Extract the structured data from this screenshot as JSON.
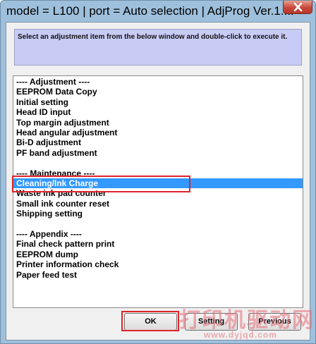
{
  "window": {
    "title": "model = L100 | port = Auto selection | AdjProg Ver.1....",
    "close_icon": "close-x-icon"
  },
  "instruction": "Select an adjustment item from the below window and double-click to execute it.",
  "list": {
    "items": [
      "---- Adjustment ----",
      "EEPROM Data Copy",
      "Initial setting",
      "Head ID input",
      "Top margin adjustment",
      "Head angular adjustment",
      "Bi-D adjustment",
      "PF band adjustment",
      "",
      "---- Maintenance ----",
      "Cleaning/Ink Charge",
      "Waste ink pad counter",
      "Small ink counter reset",
      "Shipping setting",
      "",
      "---- Appendix ----",
      "Final check pattern print",
      "EEPROM dump",
      "Printer information check",
      "Paper feed test"
    ],
    "selected": "Cleaning/Ink Charge"
  },
  "buttons": {
    "ok": "OK",
    "setting": "Setting",
    "previous": "Previous"
  },
  "watermark": {
    "text": "打印机驱动网",
    "url": "www.dyjqd.com"
  },
  "colors": {
    "selection": "#3399ff",
    "highlight_box": "#e0242a",
    "instruction_bg": "#c8ccf5"
  }
}
